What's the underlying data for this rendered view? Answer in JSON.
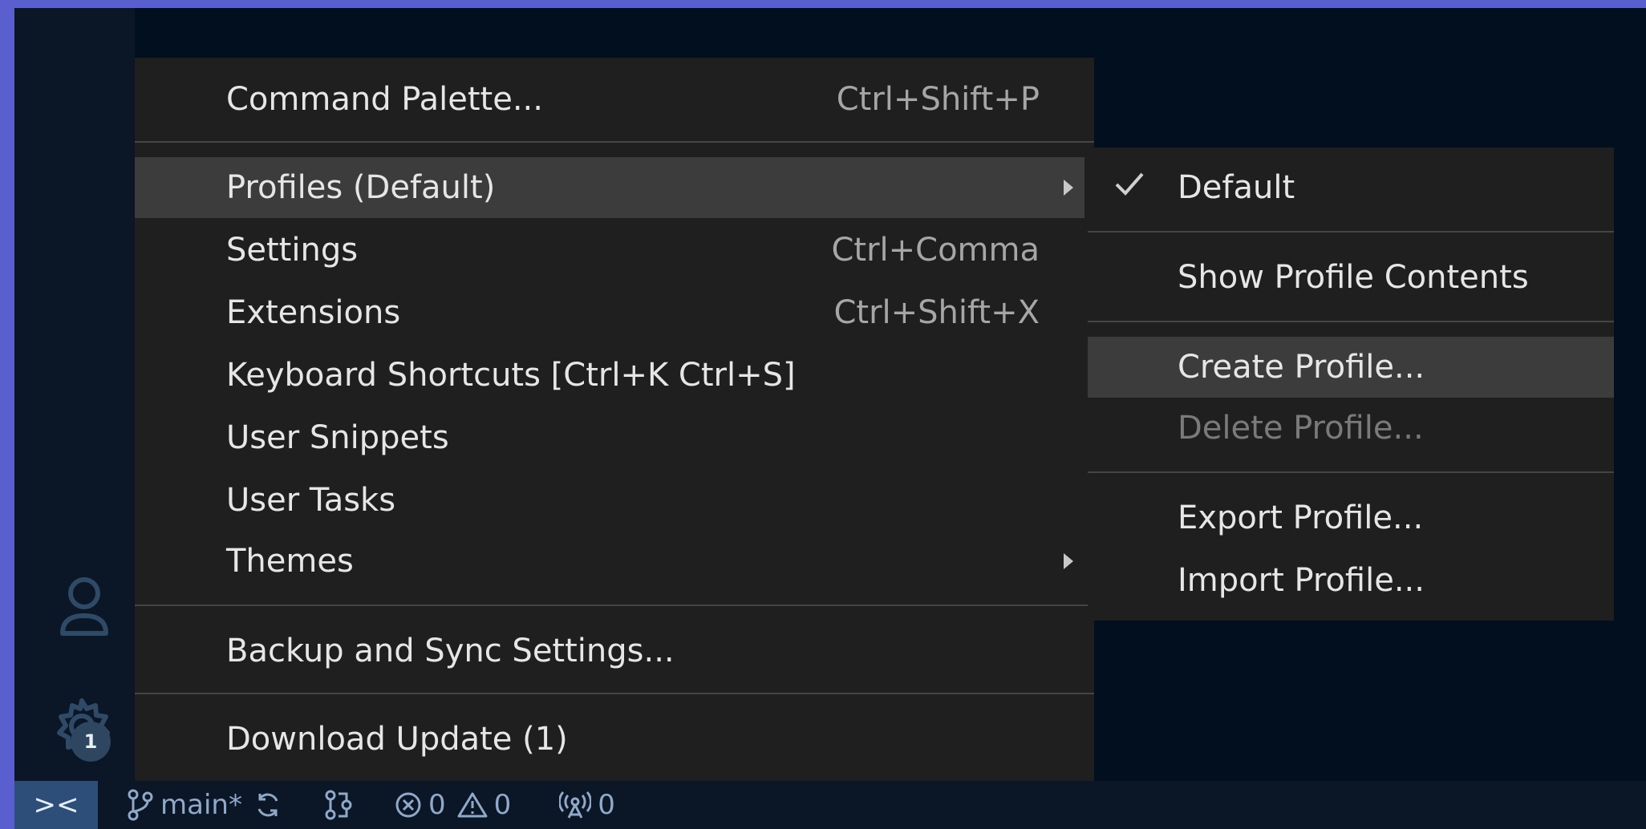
{
  "status_bar": {
    "remote_glyph": "><",
    "branch": "main*",
    "errors": "0",
    "warnings": "0",
    "ports": "0"
  },
  "activity_bar": {
    "manage_badge": "1"
  },
  "manage_menu": {
    "items": [
      {
        "label": "Command Palette...",
        "shortcut": "Ctrl+Shift+P"
      },
      {
        "label": "Profiles (Default)",
        "shortcut": ""
      },
      {
        "label": "Settings",
        "shortcut": "Ctrl+Comma"
      },
      {
        "label": "Extensions",
        "shortcut": "Ctrl+Shift+X"
      },
      {
        "label": "Keyboard Shortcuts [Ctrl+K Ctrl+S]",
        "shortcut": ""
      },
      {
        "label": "User Snippets",
        "shortcut": ""
      },
      {
        "label": "User Tasks",
        "shortcut": ""
      },
      {
        "label": "Themes",
        "shortcut": ""
      },
      {
        "label": "Backup and Sync Settings...",
        "shortcut": ""
      },
      {
        "label": "Download Update (1)",
        "shortcut": ""
      }
    ]
  },
  "profiles_submenu": {
    "items": [
      {
        "label": "Default"
      },
      {
        "label": "Show Profile Contents"
      },
      {
        "label": "Create Profile..."
      },
      {
        "label": "Delete Profile..."
      },
      {
        "label": "Export Profile..."
      },
      {
        "label": "Import Profile..."
      }
    ]
  },
  "colors": {
    "menu_background": "#1f1f1f",
    "menu_highlight": "#3c3c3c",
    "editor_background": "#010f1f",
    "window_border": "#5a5fd0"
  }
}
